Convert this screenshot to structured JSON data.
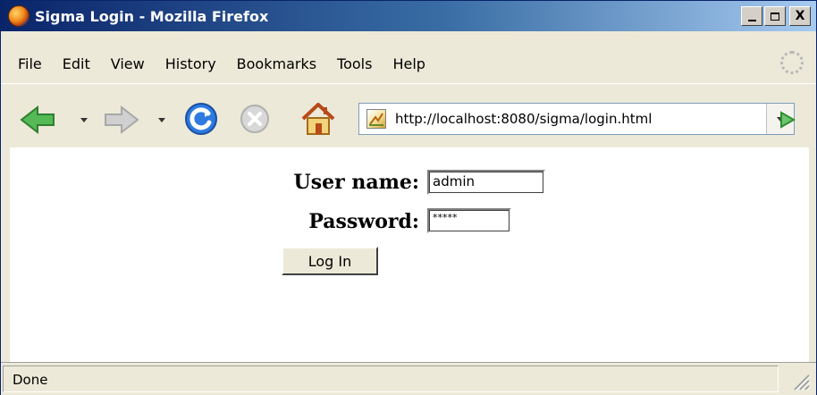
{
  "window": {
    "title": "Sigma Login - Mozilla Firefox",
    "controls": {
      "minimize": "_",
      "close": "X"
    }
  },
  "menu": {
    "items": [
      {
        "label": "File"
      },
      {
        "label": "Edit"
      },
      {
        "label": "View"
      },
      {
        "label": "History"
      },
      {
        "label": "Bookmarks"
      },
      {
        "label": "Tools"
      },
      {
        "label": "Help"
      }
    ]
  },
  "navigation": {
    "url": "http://localhost:8080/sigma/login.html",
    "icons": [
      "back-arrow-icon",
      "forward-arrow-icon",
      "reload-icon",
      "stop-icon",
      "home-icon",
      "go-arrow-icon"
    ]
  },
  "form": {
    "username_label": "User name:",
    "username_value": "admin",
    "password_label": "Password:",
    "password_value": "*****",
    "login_button": "Log In"
  },
  "status": {
    "text": "Done"
  },
  "colors": {
    "titlebar_dark": "#0a246a",
    "titlebar_light": "#a6caf0",
    "chrome": "#ece9d8",
    "back_arrow": "#3aa53a",
    "reload": "#2d7ae0",
    "go_arrow": "#3aa53a"
  }
}
